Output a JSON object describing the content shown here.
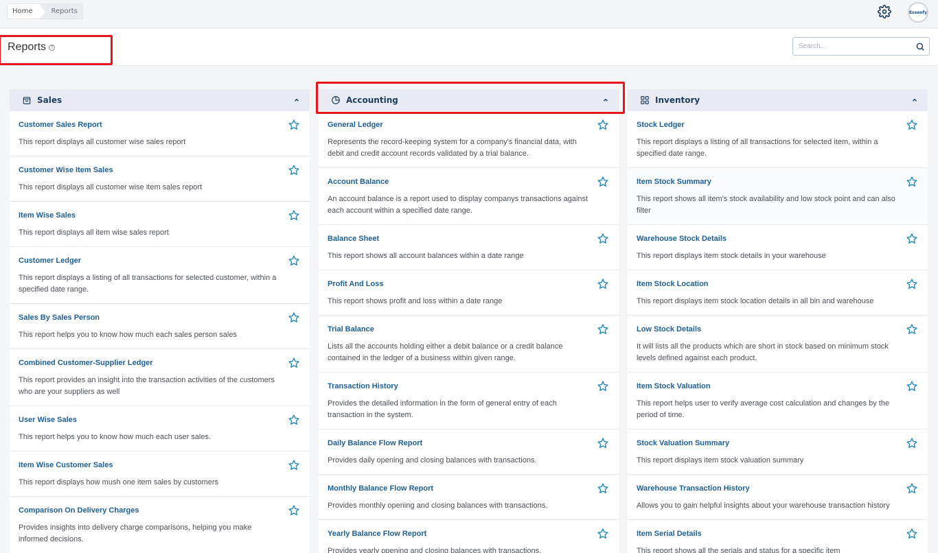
{
  "breadcrumb": {
    "home": "Home",
    "current": "Reports"
  },
  "avatar_text": "Essenfy",
  "page": {
    "title": "Reports",
    "help": "?"
  },
  "search": {
    "placeholder": "Search..."
  },
  "colors": {
    "link": "#1e5f92",
    "header_bg": "#e8eaf4",
    "star": "#1e87b8",
    "highlight": "#e8161b"
  },
  "columns": [
    {
      "title": "Sales",
      "icon": "shopping-bag-icon",
      "items": [
        {
          "title": "Customer Sales Report",
          "desc": "This report displays all customer wise sales report"
        },
        {
          "title": "Customer Wise Item Sales",
          "desc": "This report displays all customer wise item sales report"
        },
        {
          "title": "Item Wise Sales",
          "desc": "This report displays all item wise sales report"
        },
        {
          "title": "Customer Ledger",
          "desc": "This report displays a listing of all transactions for selected customer, within a specified date range."
        },
        {
          "title": "Sales By Sales Person",
          "desc": "This report helps you to know how much each sales person sales"
        },
        {
          "title": "Combined Customer-Supplier Ledger",
          "desc": "This report provides an insight into the transaction activities of the customers who are your suppliers as well"
        },
        {
          "title": "User Wise Sales",
          "desc": "This report helps you to know how much each user sales."
        },
        {
          "title": "Item Wise Customer Sales",
          "desc": "This report displays how mush one item sales by customers"
        },
        {
          "title": "Comparison On Delivery Charges",
          "desc": "Provides insights into delivery charge comparisons, helping you make informed decisions."
        }
      ]
    },
    {
      "title": "Accounting",
      "icon": "pie-chart-icon",
      "items": [
        {
          "title": "General Ledger",
          "desc": "Represents the record-keeping system for a company's financial data, with debit and credit account records validated by a trial balance."
        },
        {
          "title": "Account Balance",
          "desc": "An account balance is a report used to display companys transactions against each account within a specified date range."
        },
        {
          "title": "Balance Sheet",
          "desc": "This report shows all account balances within a date range"
        },
        {
          "title": "Profit And Loss",
          "desc": "This report shows profit and loss within a date range"
        },
        {
          "title": "Trial Balance",
          "desc": "Lists all the accounts holding either a debit balance or a credit balance contained in the ledger of a business within given range."
        },
        {
          "title": "Transaction History",
          "desc": "Provides the detailed information in the form of general entry of each transaction in the system."
        },
        {
          "title": "Daily Balance Flow Report",
          "desc": "Provides daily opening and closing balances with transactions."
        },
        {
          "title": "Monthly Balance Flow Report",
          "desc": "Provides monthly opening and closing balances with transactions."
        },
        {
          "title": "Yearly Balance Flow Report",
          "desc": "Provides yearly opening and closing balances with transactions."
        }
      ]
    },
    {
      "title": "Inventory",
      "icon": "grid-icon",
      "items": [
        {
          "title": "Stock Ledger",
          "desc": "This report displays a listing of all transactions for selected item, within a specified date range."
        },
        {
          "title": "Item Stock Summary",
          "desc": "This report shows all item's stock availability and low stock point and can also filter"
        },
        {
          "title": "Warehouse Stock Details",
          "desc": "This report displays item stock details in your warehouse"
        },
        {
          "title": "Item Stock Location",
          "desc": "This report displays item stock location details in all bin and warehouse"
        },
        {
          "title": "Low Stock Details",
          "desc": "It will lists all the products which are short in stock based on minimum stock levels defined against each product."
        },
        {
          "title": "Item Stock Valuation",
          "desc": "This report helps user to verify average cost calculation and changes by the period of time."
        },
        {
          "title": "Stock Valuation Summary",
          "desc": "This report displays item stock valuation summary"
        },
        {
          "title": "Warehouse Transaction History",
          "desc": "Allows you to gain helpful insights about your warehouse transaction history"
        },
        {
          "title": "Item Serial Details",
          "desc": "This report shows all the serials and status for a specific item"
        }
      ]
    }
  ]
}
